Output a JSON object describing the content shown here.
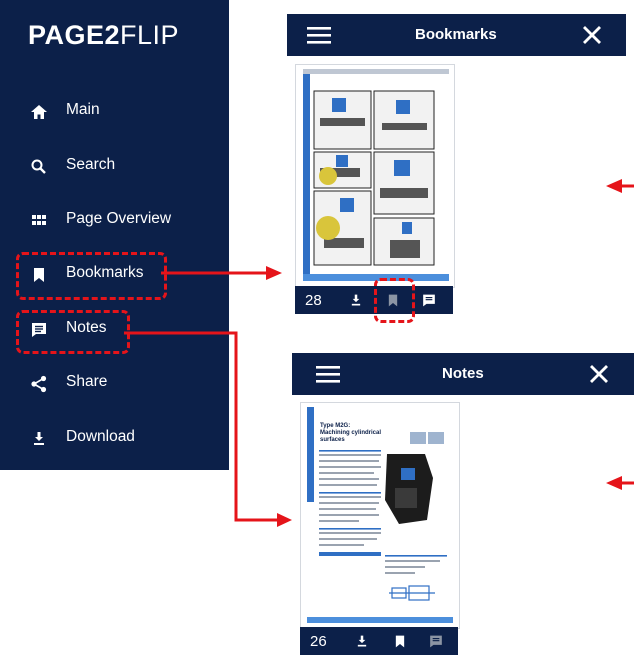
{
  "logo": {
    "part1": "PAGE2",
    "part2": "FLIP"
  },
  "menu": [
    {
      "label": "Main",
      "icon": "home-icon"
    },
    {
      "label": "Search",
      "icon": "search-icon"
    },
    {
      "label": "Page Overview",
      "icon": "grid-icon"
    },
    {
      "label": "Bookmarks",
      "icon": "bookmark-icon"
    },
    {
      "label": "Notes",
      "icon": "note-icon"
    },
    {
      "label": "Share",
      "icon": "share-icon"
    },
    {
      "label": "Download",
      "icon": "download-icon"
    }
  ],
  "bookmarks_screen": {
    "title": "Bookmarks",
    "page_number": "28"
  },
  "notes_screen": {
    "title": "Notes",
    "page_number": "26"
  },
  "doc_text": {
    "heading_line1": "Type M2G:",
    "heading_line2": "Machining cylindrical",
    "heading_line3": "surfaces"
  },
  "colors": {
    "navy": "#0c2049",
    "accent_red": "#e5141a",
    "doc_blue": "#2f6fc4"
  }
}
